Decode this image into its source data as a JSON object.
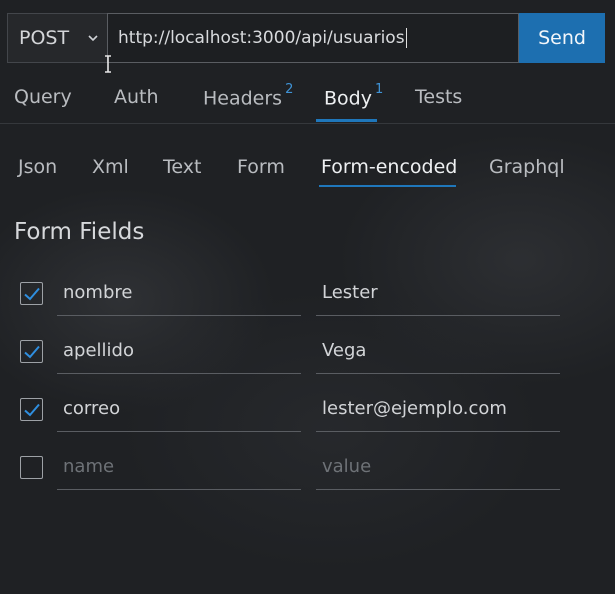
{
  "request": {
    "method": "POST",
    "url": "http://localhost:3000/api/usuarios",
    "send_label": "Send"
  },
  "tabs": [
    {
      "label": "Query",
      "badge": ""
    },
    {
      "label": "Auth",
      "badge": ""
    },
    {
      "label": "Headers",
      "badge": "2"
    },
    {
      "label": "Body",
      "badge": "1"
    },
    {
      "label": "Tests",
      "badge": ""
    }
  ],
  "active_tab": "Body",
  "body_types": [
    "Json",
    "Xml",
    "Text",
    "Form",
    "Form-encoded",
    "Graphql"
  ],
  "active_body_type": "Form-encoded",
  "section_title": "Form Fields",
  "fields": [
    {
      "checked": true,
      "name": "nombre",
      "value": "Lester"
    },
    {
      "checked": true,
      "name": "apellido",
      "value": "Vega"
    },
    {
      "checked": true,
      "name": "correo",
      "value": "lester@ejemplo.com"
    }
  ],
  "new_field": {
    "checked": false,
    "name_placeholder": "name",
    "value_placeholder": "value"
  },
  "colors": {
    "accent": "#1d6fb0",
    "background": "#222427"
  },
  "icons": {
    "dropdown": "chevron-down-icon",
    "check": "check-icon",
    "cursor": "text-cursor-icon"
  }
}
